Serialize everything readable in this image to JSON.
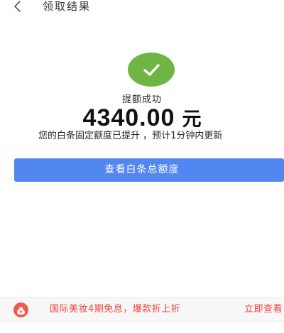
{
  "header": {
    "title": "领取结果"
  },
  "result": {
    "status": "提额成功",
    "amount": "4340.00",
    "unit": "元",
    "description": "您的白条固定额度已提升 ，预计1分钟内更新"
  },
  "actions": {
    "view_limit_label": "查看白条总额度"
  },
  "promo": {
    "text": "国际美妆4期免息，爆款折上折",
    "link_label": "立即查看"
  },
  "colors": {
    "success_green": "#6fb544",
    "primary_blue": "#5286f0",
    "promo_red": "#e8453c"
  },
  "icons": {
    "back": "chevron-left-icon",
    "success": "checkmark-icon",
    "promo": "money-bag-icon"
  }
}
